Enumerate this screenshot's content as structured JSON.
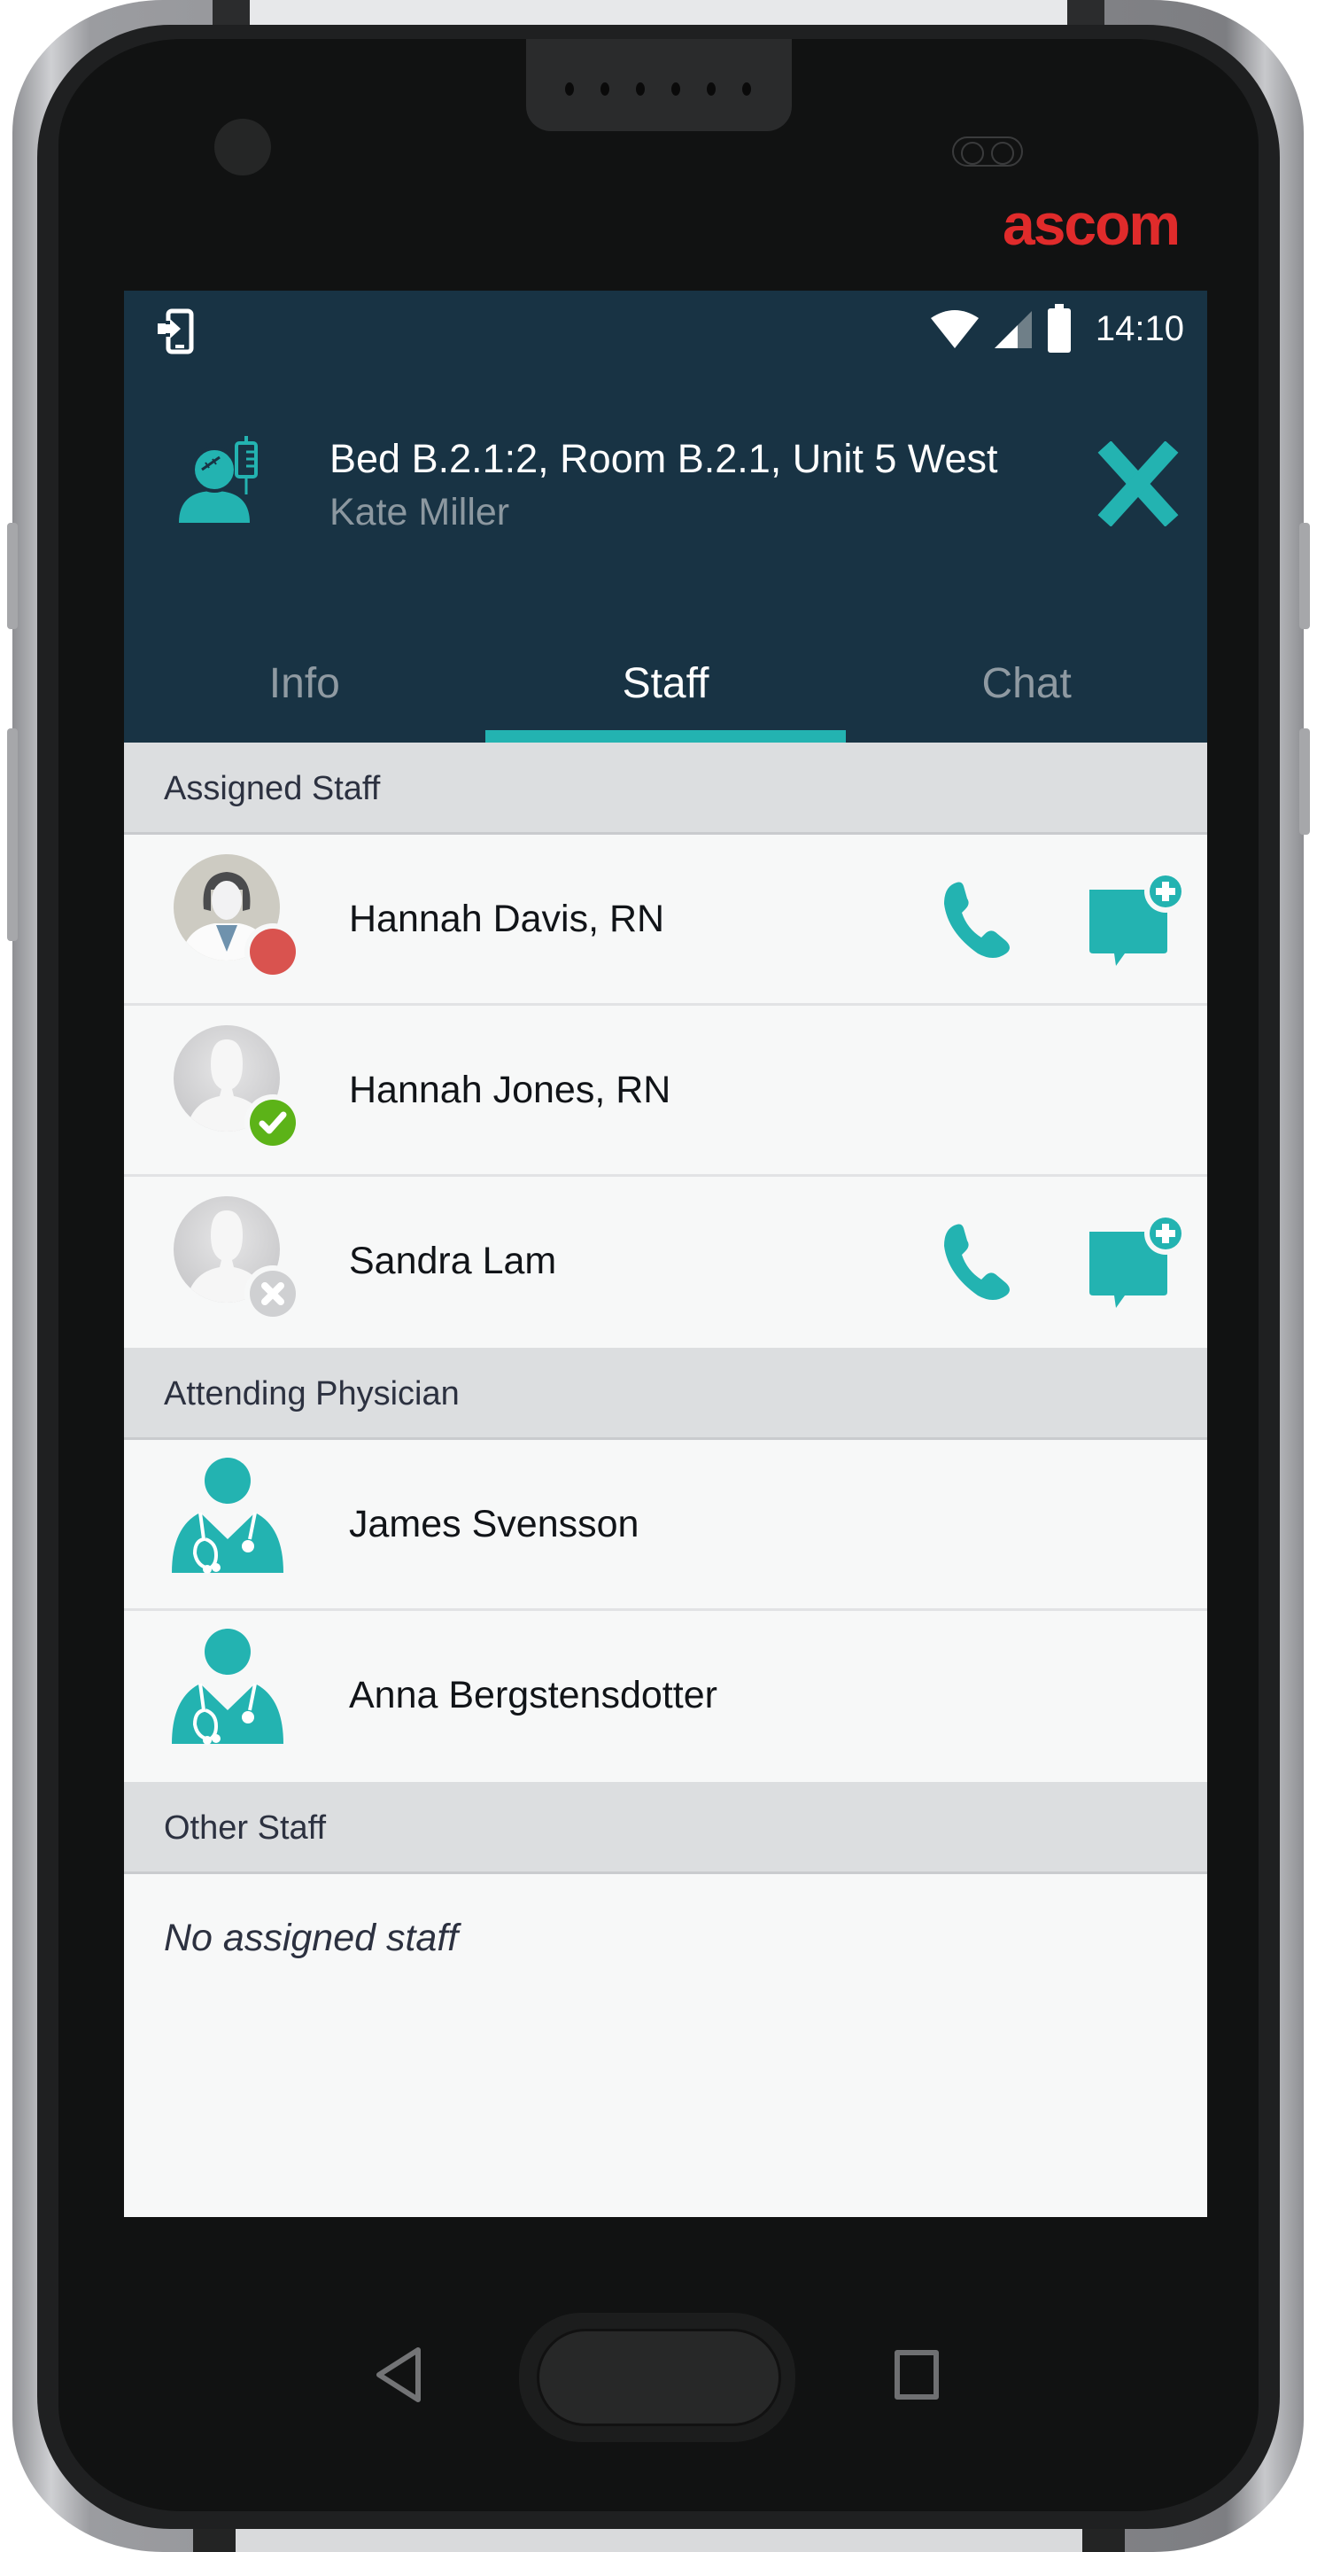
{
  "device": {
    "brand": "ascom"
  },
  "status_bar": {
    "left_icon": "phone-login-icon",
    "icons": [
      "wifi-icon",
      "cellular-signal-icon",
      "battery-icon"
    ],
    "time": "14:10"
  },
  "header": {
    "patient_icon": "patient-iv-icon",
    "location": "Bed B.2.1:2, Room B.2.1, Unit 5 West",
    "patient_name": "Kate Miller",
    "close_icon": "close-icon"
  },
  "tabs": [
    {
      "label": "Info",
      "active": false
    },
    {
      "label": "Staff",
      "active": true
    },
    {
      "label": "Chat",
      "active": false
    }
  ],
  "sections": {
    "assigned": {
      "title": "Assigned Staff",
      "items": [
        {
          "name": "Hannah Davis, RN",
          "avatar": "photo",
          "presence": "busy",
          "can_call": true,
          "can_message": true
        },
        {
          "name": "Hannah Jones, RN",
          "avatar": "placeholder",
          "presence": "available",
          "can_call": false,
          "can_message": false
        },
        {
          "name": "Sandra Lam",
          "avatar": "placeholder",
          "presence": "offline",
          "can_call": true,
          "can_message": true
        }
      ]
    },
    "physician": {
      "title": "Attending Physician",
      "items": [
        {
          "name": "James Svensson",
          "avatar": "doctor-icon"
        },
        {
          "name": "Anna Bergstensdotter",
          "avatar": "doctor-icon"
        }
      ]
    },
    "other": {
      "title": "Other Staff",
      "empty_text": "No assigned staff"
    }
  },
  "colors": {
    "header_bg": "#183344",
    "accent": "#23b3b1",
    "presence_busy": "#d9534f",
    "presence_available": "#5cb318",
    "presence_offline": "#cfd0d2",
    "brand_red": "#e02b2b"
  },
  "navigation": {
    "back_icon": "back-icon",
    "home_icon": "home-button",
    "recent_icon": "recent-apps-icon"
  }
}
